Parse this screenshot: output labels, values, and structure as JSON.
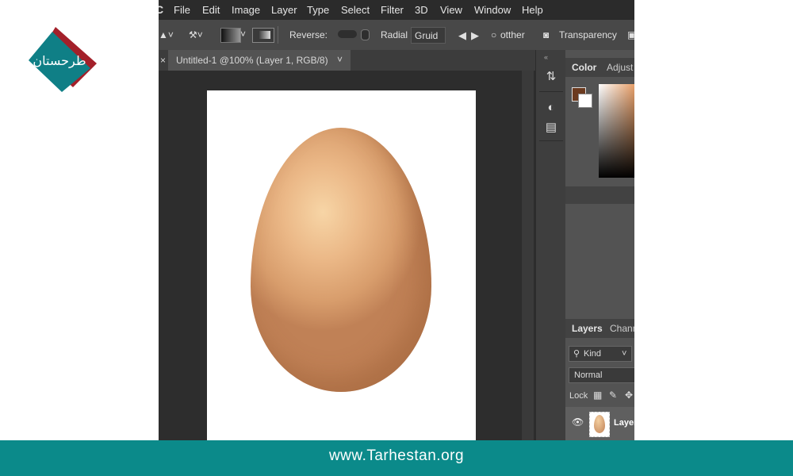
{
  "app_letter": "C",
  "menu": [
    "File",
    "Edit",
    "Image",
    "Layer",
    "Type",
    "Select",
    "Filter",
    "3D",
    "View",
    "Window",
    "Help"
  ],
  "options_bar": {
    "reverse_label": "Reverse:",
    "radial_label": "Radial",
    "gruid_label": "Gruid",
    "otther_label": "otther",
    "transparency_label": "Transparency"
  },
  "document_tab": {
    "close": "×",
    "title": "Untitled-1 @100% (Layer 1, RGB/8)",
    "chevron": "˅"
  },
  "panels": {
    "color_tab": "Color",
    "adjust_tab": "Adjust",
    "layers_tab": "Layers",
    "channels_tab": "Chann",
    "kind_label": "Kind",
    "blend_mode": "Normal",
    "lock_label": "Lock",
    "layer_name": "Layer"
  },
  "colors": {
    "foreground": "#6b3a1f",
    "background": "#ffffff",
    "footer": "#0b8a8a",
    "logo_teal": "#0f7f86",
    "logo_red": "#a3202a"
  },
  "logo": {
    "text": "طرحستان"
  },
  "footer": {
    "url": "www.Tarhestan.org"
  }
}
